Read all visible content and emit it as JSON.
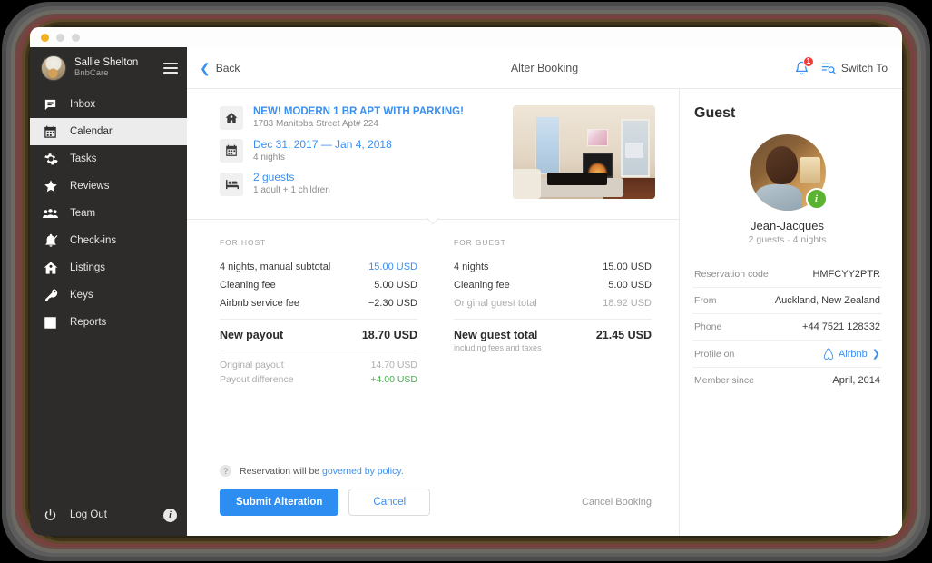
{
  "window": {
    "dots": [
      "close",
      "minimize",
      "maximize"
    ],
    "dot_colors": {
      "close": "#f2b01e",
      "minimize": "#d8d8d8",
      "maximize": "#d8d8d8"
    }
  },
  "sidebar": {
    "user": {
      "name": "Sallie Shelton",
      "org": "BnbCare",
      "avatar": "user-avatar"
    },
    "menu_icon": "hamburger-icon",
    "items": [
      {
        "label": "Inbox",
        "icon": "inbox-icon",
        "active": false
      },
      {
        "label": "Calendar",
        "icon": "calendar-icon",
        "active": true
      },
      {
        "label": "Tasks",
        "icon": "gear-icon",
        "active": false
      },
      {
        "label": "Reviews",
        "icon": "star-icon",
        "active": false
      },
      {
        "label": "Team",
        "icon": "people-icon",
        "active": false
      },
      {
        "label": "Check-ins",
        "icon": "bell-check-icon",
        "active": false
      },
      {
        "label": "Listings",
        "icon": "home-icon",
        "active": false
      },
      {
        "label": "Keys",
        "icon": "key-icon",
        "active": false
      },
      {
        "label": "Reports",
        "icon": "bar-chart-icon",
        "active": false
      }
    ],
    "logout": {
      "label": "Log Out",
      "icon": "power-icon"
    },
    "info_badge": "i",
    "bg_color": "#2e2c2b",
    "active_bg_color": "#ececec"
  },
  "topbar": {
    "back_label": "Back",
    "back_icon": "chevron-left-icon",
    "title": "Alter Booking",
    "bell_icon": "bell-icon",
    "bell_badge": "1",
    "switch_to_label": "Switch To",
    "switch_to_icon": "list-search-icon",
    "badge_color": "#ef3d3d",
    "accent_color": "#3b8ff0"
  },
  "summary": {
    "listing": {
      "icon": "home-icon",
      "title": "NEW! MODERN 1 BR APT WITH PARKING!",
      "subtitle": "1783 Manitoba Street Apt# 224"
    },
    "dates": {
      "icon": "calendar-icon",
      "title": "Dec 31, 2017 — Jan 4, 2018",
      "subtitle": "4 nights"
    },
    "guests": {
      "icon": "bed-icon",
      "title": "2 guests",
      "subtitle": "1 adult + 1 children"
    },
    "photo_alt": "property-photo"
  },
  "pricing": {
    "host": {
      "heading": "FOR HOST",
      "lines": [
        {
          "label": "4 nights, manual subtotal",
          "value": "15.00 USD",
          "style": "blue"
        },
        {
          "label": "Cleaning fee",
          "value": "5.00 USD",
          "style": "plain"
        },
        {
          "label": "Airbnb service fee",
          "value": "−2.30 USD",
          "style": "plain"
        }
      ],
      "total": {
        "label": "New payout",
        "value": "18.70 USD"
      },
      "extra": [
        {
          "label": "Original payout",
          "value": "14.70 USD",
          "style": "muted"
        },
        {
          "label": "Payout difference",
          "value": "+4.00 USD",
          "style": "green"
        }
      ]
    },
    "guest": {
      "heading": "FOR GUEST",
      "lines": [
        {
          "label": "4 nights",
          "value": "15.00 USD",
          "style": "plain"
        },
        {
          "label": "Cleaning fee",
          "value": "5.00 USD",
          "style": "plain"
        },
        {
          "label": "Original guest total",
          "value": "18.92 USD",
          "style": "muted"
        }
      ],
      "total": {
        "label": "New guest total",
        "value": "21.45 USD",
        "sub": "including fees and taxes"
      }
    }
  },
  "actions": {
    "policy_icon": "question-icon",
    "policy_text": "Reservation will be ",
    "policy_link": "governed by policy.",
    "submit_label": "Submit Alteration",
    "cancel_label": "Cancel",
    "cancel_booking_label": "Cancel Booking",
    "submit_color": "#2e8df0"
  },
  "guest_panel": {
    "heading": "Guest",
    "avatar_alt": "guest-avatar",
    "verified_badge": "i",
    "verified_color": "#5ab431",
    "name": "Jean-Jacques",
    "meta": "2 guests · 4 nights",
    "rows": [
      {
        "label": "Reservation code",
        "value": "HMFCYY2PTR",
        "type": "text"
      },
      {
        "label": "From",
        "value": "Auckland, New Zealand",
        "type": "text"
      },
      {
        "label": "Phone",
        "value": "+44 7521 128332",
        "type": "text"
      },
      {
        "label": "Profile on",
        "value": "Airbnb",
        "type": "link"
      },
      {
        "label": "Member since",
        "value": "April, 2014",
        "type": "text"
      }
    ]
  }
}
